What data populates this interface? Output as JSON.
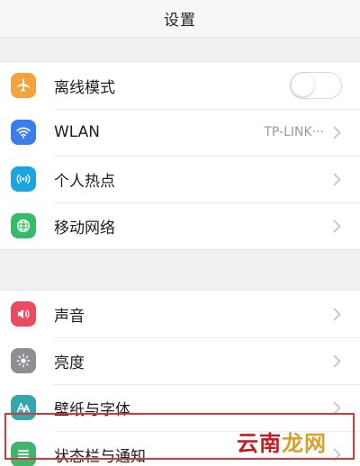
{
  "header": {
    "title": "设置"
  },
  "group1": {
    "items": [
      {
        "label": "离线模式",
        "icon": "airplane-icon",
        "color": "#f3a33a",
        "toggle": "off"
      },
      {
        "label": "WLAN",
        "icon": "wifi-icon",
        "color": "#3b7de9",
        "value": "TP-LINK···"
      },
      {
        "label": "个人热点",
        "icon": "hotspot-icon",
        "color": "#1aa5e0"
      },
      {
        "label": "移动网络",
        "icon": "globe-icon",
        "color": "#36bb6a"
      }
    ]
  },
  "group2": {
    "items": [
      {
        "label": "声音",
        "icon": "speaker-icon",
        "color": "#ee4a5f"
      },
      {
        "label": "亮度",
        "icon": "brightness-icon",
        "color": "#8e8e93"
      },
      {
        "label": "壁纸与字体",
        "icon": "wallpaper-font-icon",
        "color": "#36a6ad"
      },
      {
        "label": "状态栏与通知",
        "icon": "status-bar-icon",
        "color": "#43b46b"
      }
    ]
  },
  "watermark": {
    "text_part1": "云南",
    "text_part2": "龙网"
  },
  "colors": {
    "highlight": "#d23a3a",
    "background": "#f1f1f3"
  }
}
